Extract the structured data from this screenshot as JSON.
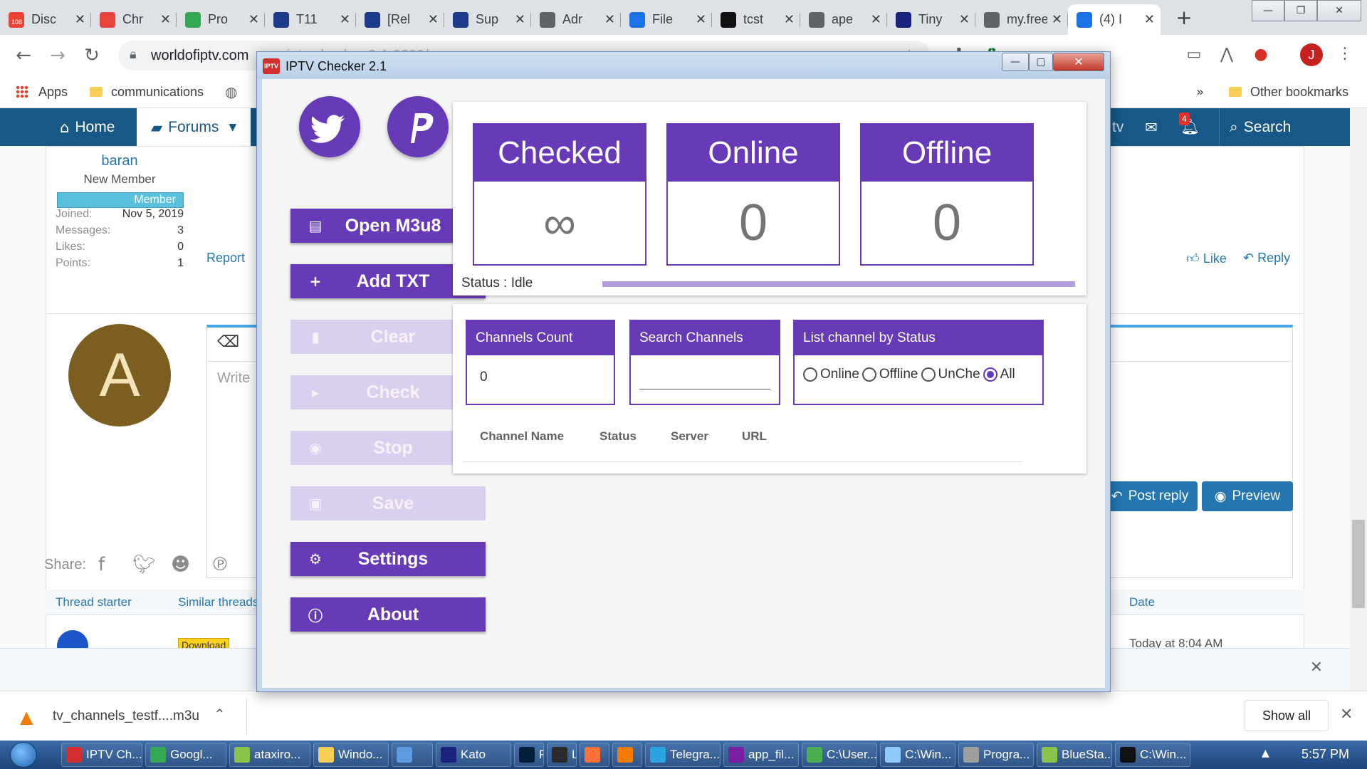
{
  "browser": {
    "tabs": [
      {
        "title": "Disc",
        "favicon": "discord-icon",
        "badge": "108",
        "color": "#ea4335"
      },
      {
        "title": "Chr",
        "favicon": "chrome-webstore-icon",
        "color": "#e8453c"
      },
      {
        "title": "Pro",
        "favicon": "wifi-icon",
        "color": "#34a853"
      },
      {
        "title": "T11",
        "favicon": "bird-icon",
        "color": "#1e3a8a"
      },
      {
        "title": "[Rel",
        "favicon": "bird-icon",
        "color": "#1e3a8a"
      },
      {
        "title": "Sup",
        "favicon": "bird-icon",
        "color": "#1e3a8a"
      },
      {
        "title": "Adr",
        "favicon": "globe-icon",
        "color": "#5f6368"
      },
      {
        "title": "File",
        "favicon": "share-icon",
        "color": "#1a73e8"
      },
      {
        "title": "tcst",
        "favicon": "building-icon",
        "color": "#111111"
      },
      {
        "title": "ape",
        "favicon": "globe-icon",
        "color": "#5f6368"
      },
      {
        "title": "Tiny",
        "favicon": "tinyurl-icon",
        "color": "#1a237e"
      },
      {
        "title": "my.freen",
        "favicon": "fn-icon",
        "color": "#5f6368"
      },
      {
        "title": "(4) I",
        "favicon": "forum-icon",
        "color": "#1a73e8"
      }
    ],
    "url": "worldofiptv.com",
    "url_faded": "...iptv-checker-2-1.6209/",
    "bookmarks": {
      "apps": "Apps",
      "communications": "communications",
      "other": "Other bookmarks"
    }
  },
  "forum": {
    "nav": {
      "home": "Home",
      "forums": "Forums",
      "search": "Search",
      "tv": "tv",
      "alerts_count": "4"
    },
    "user": {
      "name": "baran",
      "title": "New Member",
      "badge": "Member",
      "stats": [
        {
          "label": "Joined:",
          "value": "Nov 5, 2019"
        },
        {
          "label": "Messages:",
          "value": "3"
        },
        {
          "label": "Likes:",
          "value": "0"
        },
        {
          "label": "Points:",
          "value": "1"
        }
      ]
    },
    "report": "Report",
    "like": "Like",
    "reply": "Reply",
    "avatar_letter": "A",
    "write_placeholder": "Write",
    "post_reply": "Post reply",
    "preview": "Preview",
    "share": "Share:",
    "thread_starter": "Thread starter",
    "similar_threads": "Similar threads",
    "date": "Date",
    "download_badge": "Download",
    "date_value": "Today at 8:04 AM"
  },
  "downloads": {
    "file": "tv_channels_testf....m3u",
    "show_all": "Show all"
  },
  "taskbar": {
    "items": [
      {
        "label": "IPTV Ch...",
        "color": "#d32f2f"
      },
      {
        "label": "Googl...",
        "color": "#34a853"
      },
      {
        "label": "ataxiro...",
        "color": "#8bc34a"
      },
      {
        "label": "Windo...",
        "color": "#f9ce54"
      },
      {
        "label": "",
        "color": "#5f9ae0"
      },
      {
        "label": "Kato",
        "color": "#1a237e"
      },
      {
        "label": "Ps",
        "color": "#001e36"
      },
      {
        "label": "Lr",
        "color": "#2b2b2b"
      },
      {
        "label": "",
        "color": "#ff7139"
      },
      {
        "label": "",
        "color": "#f57c00"
      },
      {
        "label": "Telegra...",
        "color": "#2aa3e0"
      },
      {
        "label": "app_fil...",
        "color": "#7b1fa2"
      },
      {
        "label": "C:\\User...",
        "color": "#4caf50"
      },
      {
        "label": "C:\\Win...",
        "color": "#90caf9"
      },
      {
        "label": "Progra...",
        "color": "#9e9e9e"
      },
      {
        "label": "BlueSta...",
        "color": "#8bc34a"
      },
      {
        "label": "C:\\Win...",
        "color": "#111111"
      }
    ],
    "clock": "5:57 PM"
  },
  "app": {
    "title": "IPTV Checker 2.1",
    "icon_text": "IPTV",
    "colors": {
      "accent": "#673ab7",
      "disabled": "#d9cfee"
    },
    "buttons": [
      {
        "label": "Open M3u8",
        "icon": "file-plus-icon",
        "enabled": true
      },
      {
        "label": "Add TXT",
        "icon": "plus-icon",
        "enabled": true
      },
      {
        "label": "Clear",
        "icon": "trash-icon",
        "enabled": false
      },
      {
        "label": "Check",
        "icon": "play-icon",
        "enabled": false
      },
      {
        "label": "Stop",
        "icon": "stop-icon",
        "enabled": false
      },
      {
        "label": "Save",
        "icon": "save-icon",
        "enabled": false
      },
      {
        "label": "Settings",
        "icon": "gear-icon",
        "enabled": true
      },
      {
        "label": "About",
        "icon": "info-icon",
        "enabled": true
      }
    ],
    "stats": [
      {
        "label": "Checked",
        "value": "∞"
      },
      {
        "label": "Online",
        "value": "0"
      },
      {
        "label": "Offline",
        "value": "0"
      }
    ],
    "status": "Status : Idle",
    "channels_count": {
      "label": "Channels Count",
      "value": "0"
    },
    "search": {
      "label": "Search Channels",
      "value": ""
    },
    "filter": {
      "label": "List channel by Status",
      "options": [
        "Online",
        "Offline",
        "UnChe",
        "All"
      ],
      "selected": "All"
    },
    "columns": [
      "Channel Name",
      "Status",
      "Server",
      "URL"
    ]
  }
}
